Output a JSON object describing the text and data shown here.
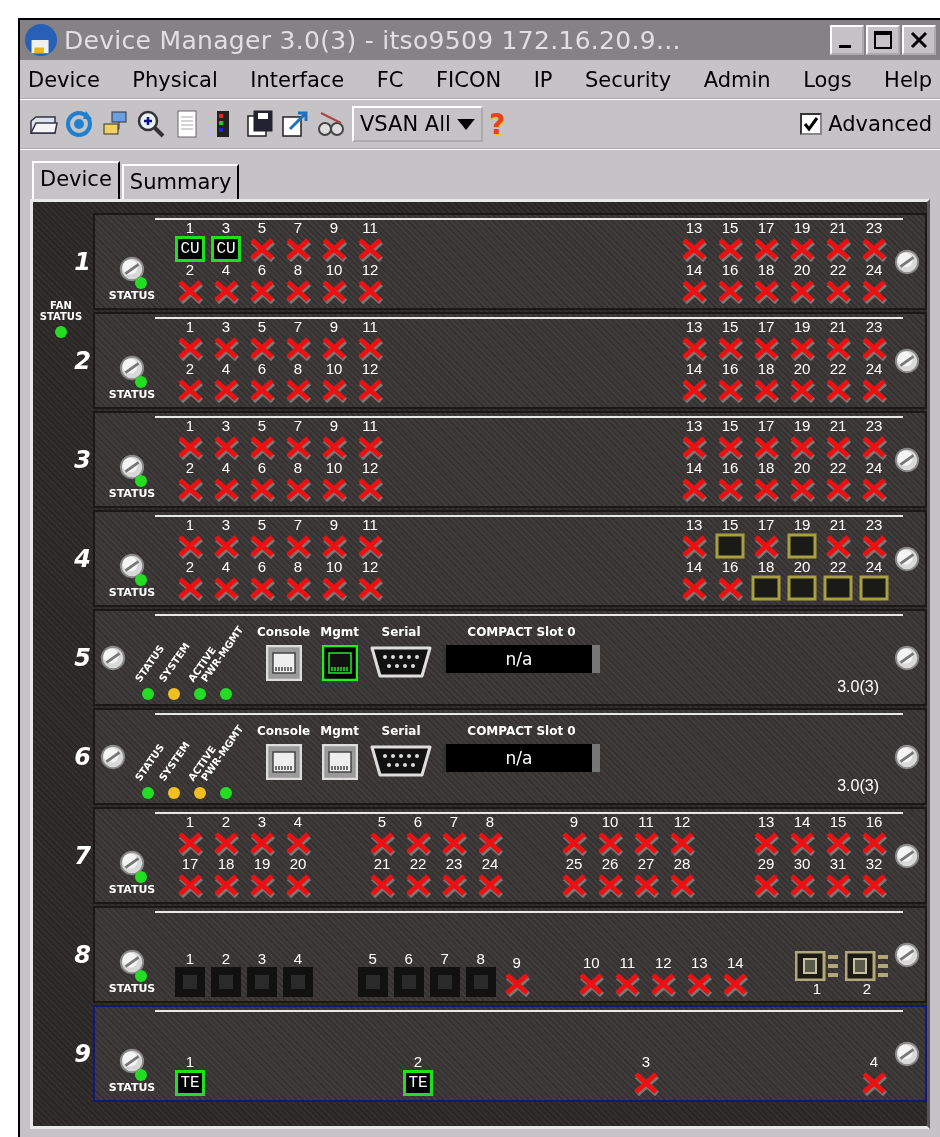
{
  "window": {
    "title": "Device Manager 3.0(3) - itso9509 172.16.20.9..."
  },
  "menu": [
    "Device",
    "Physical",
    "Interface",
    "FC",
    "FICON",
    "IP",
    "Security",
    "Admin",
    "Logs",
    "Help"
  ],
  "toolbar": {
    "vsan": "VSAN All",
    "help": "?",
    "advanced": {
      "label": "Advanced",
      "checked": true
    }
  },
  "tabs": [
    {
      "label": "Device",
      "selected": true
    },
    {
      "label": "Summary",
      "selected": false
    }
  ],
  "fan_status": "FAN STATUS",
  "slots": [
    {
      "number": "1",
      "kind": "ports",
      "selected": false,
      "status": "STATUS",
      "groups": [
        {
          "rows": [
            [
              {
                "label": "1",
                "kind": "up",
                "text": "CU"
              },
              {
                "label": "3",
                "kind": "up",
                "text": "CU"
              },
              {
                "label": "5",
                "kind": "down"
              },
              {
                "label": "7",
                "kind": "down"
              },
              {
                "label": "9",
                "kind": "down"
              },
              {
                "label": "11",
                "kind": "down"
              }
            ],
            [
              {
                "label": "2",
                "kind": "down"
              },
              {
                "label": "4",
                "kind": "down"
              },
              {
                "label": "6",
                "kind": "down"
              },
              {
                "label": "8",
                "kind": "down"
              },
              {
                "label": "10",
                "kind": "down"
              },
              {
                "label": "12",
                "kind": "down"
              }
            ]
          ]
        },
        {
          "rows": [
            [
              {
                "label": "13",
                "kind": "down"
              },
              {
                "label": "15",
                "kind": "down"
              },
              {
                "label": "17",
                "kind": "down"
              },
              {
                "label": "19",
                "kind": "down"
              },
              {
                "label": "21",
                "kind": "down"
              },
              {
                "label": "23",
                "kind": "down"
              }
            ],
            [
              {
                "label": "14",
                "kind": "down"
              },
              {
                "label": "16",
                "kind": "down"
              },
              {
                "label": "18",
                "kind": "down"
              },
              {
                "label": "20",
                "kind": "down"
              },
              {
                "label": "22",
                "kind": "down"
              },
              {
                "label": "24",
                "kind": "down"
              }
            ]
          ]
        }
      ]
    },
    {
      "number": "2",
      "kind": "ports",
      "selected": false,
      "status": "STATUS",
      "groups": [
        {
          "rows": [
            [
              {
                "label": "1",
                "kind": "down"
              },
              {
                "label": "3",
                "kind": "down"
              },
              {
                "label": "5",
                "kind": "down"
              },
              {
                "label": "7",
                "kind": "down"
              },
              {
                "label": "9",
                "kind": "down"
              },
              {
                "label": "11",
                "kind": "down"
              }
            ],
            [
              {
                "label": "2",
                "kind": "down"
              },
              {
                "label": "4",
                "kind": "down"
              },
              {
                "label": "6",
                "kind": "down"
              },
              {
                "label": "8",
                "kind": "down"
              },
              {
                "label": "10",
                "kind": "down"
              },
              {
                "label": "12",
                "kind": "down"
              }
            ]
          ]
        },
        {
          "rows": [
            [
              {
                "label": "13",
                "kind": "down"
              },
              {
                "label": "15",
                "kind": "down"
              },
              {
                "label": "17",
                "kind": "down"
              },
              {
                "label": "19",
                "kind": "down"
              },
              {
                "label": "21",
                "kind": "down"
              },
              {
                "label": "23",
                "kind": "down"
              }
            ],
            [
              {
                "label": "14",
                "kind": "down"
              },
              {
                "label": "16",
                "kind": "down"
              },
              {
                "label": "18",
                "kind": "down"
              },
              {
                "label": "20",
                "kind": "down"
              },
              {
                "label": "22",
                "kind": "down"
              },
              {
                "label": "24",
                "kind": "down"
              }
            ]
          ]
        }
      ]
    },
    {
      "number": "3",
      "kind": "ports",
      "selected": false,
      "status": "STATUS",
      "groups": [
        {
          "rows": [
            [
              {
                "label": "1",
                "kind": "down"
              },
              {
                "label": "3",
                "kind": "down"
              },
              {
                "label": "5",
                "kind": "down"
              },
              {
                "label": "7",
                "kind": "down"
              },
              {
                "label": "9",
                "kind": "down"
              },
              {
                "label": "11",
                "kind": "down"
              }
            ],
            [
              {
                "label": "2",
                "kind": "down"
              },
              {
                "label": "4",
                "kind": "down"
              },
              {
                "label": "6",
                "kind": "down"
              },
              {
                "label": "8",
                "kind": "down"
              },
              {
                "label": "10",
                "kind": "down"
              },
              {
                "label": "12",
                "kind": "down"
              }
            ]
          ]
        },
        {
          "rows": [
            [
              {
                "label": "13",
                "kind": "down"
              },
              {
                "label": "15",
                "kind": "down"
              },
              {
                "label": "17",
                "kind": "down"
              },
              {
                "label": "19",
                "kind": "down"
              },
              {
                "label": "21",
                "kind": "down"
              },
              {
                "label": "23",
                "kind": "down"
              }
            ],
            [
              {
                "label": "14",
                "kind": "down"
              },
              {
                "label": "16",
                "kind": "down"
              },
              {
                "label": "18",
                "kind": "down"
              },
              {
                "label": "20",
                "kind": "down"
              },
              {
                "label": "22",
                "kind": "down"
              },
              {
                "label": "24",
                "kind": "down"
              }
            ]
          ]
        }
      ]
    },
    {
      "number": "4",
      "kind": "ports",
      "selected": false,
      "status": "STATUS",
      "groups": [
        {
          "rows": [
            [
              {
                "label": "1",
                "kind": "down"
              },
              {
                "label": "3",
                "kind": "down"
              },
              {
                "label": "5",
                "kind": "down"
              },
              {
                "label": "7",
                "kind": "down"
              },
              {
                "label": "9",
                "kind": "down"
              },
              {
                "label": "11",
                "kind": "down"
              }
            ],
            [
              {
                "label": "2",
                "kind": "down"
              },
              {
                "label": "4",
                "kind": "down"
              },
              {
                "label": "6",
                "kind": "down"
              },
              {
                "label": "8",
                "kind": "down"
              },
              {
                "label": "10",
                "kind": "down"
              },
              {
                "label": "12",
                "kind": "down"
              }
            ]
          ]
        },
        {
          "rows": [
            [
              {
                "label": "13",
                "kind": "down"
              },
              {
                "label": "15",
                "kind": "empty"
              },
              {
                "label": "17",
                "kind": "down"
              },
              {
                "label": "19",
                "kind": "empty"
              },
              {
                "label": "21",
                "kind": "down"
              },
              {
                "label": "23",
                "kind": "down"
              }
            ],
            [
              {
                "label": "14",
                "kind": "down"
              },
              {
                "label": "16",
                "kind": "down"
              },
              {
                "label": "18",
                "kind": "empty"
              },
              {
                "label": "20",
                "kind": "empty"
              },
              {
                "label": "22",
                "kind": "empty"
              },
              {
                "label": "24",
                "kind": "empty"
              }
            ]
          ]
        }
      ]
    },
    {
      "number": "5",
      "kind": "supervisor",
      "selected": false,
      "leds": [
        {
          "label": "STATUS",
          "color": "#22dd22"
        },
        {
          "label": "SYSTEM",
          "color": "#f0c020"
        },
        {
          "label": "ACTIVE",
          "color": "#22dd22"
        },
        {
          "label": "PWR-MGMT",
          "color": "#22dd22"
        }
      ],
      "connectors": [
        {
          "label": "Console",
          "kind": "rj45",
          "active": false
        },
        {
          "label": "Mgmt",
          "kind": "rj45",
          "active": true
        },
        {
          "label": "Serial",
          "kind": "db9",
          "active": false
        }
      ],
      "flash": {
        "label": "COMPACT Slot 0",
        "value": "n/a"
      },
      "version": "3.0(3)"
    },
    {
      "number": "6",
      "kind": "supervisor",
      "selected": false,
      "leds": [
        {
          "label": "STATUS",
          "color": "#22dd22"
        },
        {
          "label": "SYSTEM",
          "color": "#f0c020"
        },
        {
          "label": "ACTIVE",
          "color": "#f0c020"
        },
        {
          "label": "PWR-MGMT",
          "color": "#22dd22"
        }
      ],
      "connectors": [
        {
          "label": "Console",
          "kind": "rj45",
          "active": false
        },
        {
          "label": "Mgmt",
          "kind": "rj45",
          "active": false
        },
        {
          "label": "Serial",
          "kind": "db9",
          "active": false
        }
      ],
      "flash": {
        "label": "COMPACT Slot 0",
        "value": "n/a"
      },
      "version": "3.0(3)"
    },
    {
      "number": "7",
      "kind": "ports",
      "selected": false,
      "status": "STATUS",
      "groups": [
        {
          "rows": [
            [
              {
                "label": "1",
                "kind": "down"
              },
              {
                "label": "2",
                "kind": "down"
              },
              {
                "label": "3",
                "kind": "down"
              },
              {
                "label": "4",
                "kind": "down"
              }
            ],
            [
              {
                "label": "17",
                "kind": "down"
              },
              {
                "label": "18",
                "kind": "down"
              },
              {
                "label": "19",
                "kind": "down"
              },
              {
                "label": "20",
                "kind": "down"
              }
            ]
          ]
        },
        {
          "rows": [
            [
              {
                "label": "5",
                "kind": "down"
              },
              {
                "label": "6",
                "kind": "down"
              },
              {
                "label": "7",
                "kind": "down"
              },
              {
                "label": "8",
                "kind": "down"
              }
            ],
            [
              {
                "label": "21",
                "kind": "down"
              },
              {
                "label": "22",
                "kind": "down"
              },
              {
                "label": "23",
                "kind": "down"
              },
              {
                "label": "24",
                "kind": "down"
              }
            ]
          ]
        },
        {
          "rows": [
            [
              {
                "label": "9",
                "kind": "down"
              },
              {
                "label": "10",
                "kind": "down"
              },
              {
                "label": "11",
                "kind": "down"
              },
              {
                "label": "12",
                "kind": "down"
              }
            ],
            [
              {
                "label": "25",
                "kind": "down"
              },
              {
                "label": "26",
                "kind": "down"
              },
              {
                "label": "27",
                "kind": "down"
              },
              {
                "label": "28",
                "kind": "down"
              }
            ]
          ]
        },
        {
          "rows": [
            [
              {
                "label": "13",
                "kind": "down"
              },
              {
                "label": "14",
                "kind": "down"
              },
              {
                "label": "15",
                "kind": "down"
              },
              {
                "label": "16",
                "kind": "down"
              }
            ],
            [
              {
                "label": "29",
                "kind": "down"
              },
              {
                "label": "30",
                "kind": "down"
              },
              {
                "label": "31",
                "kind": "down"
              },
              {
                "label": "32",
                "kind": "down"
              }
            ]
          ]
        }
      ]
    },
    {
      "number": "8",
      "kind": "ports",
      "selected": false,
      "status": "STATUS",
      "groups": [
        {
          "rows": [
            [
              {
                "label": "1",
                "kind": "blank"
              },
              {
                "label": "2",
                "kind": "blank"
              },
              {
                "label": "3",
                "kind": "blank"
              },
              {
                "label": "4",
                "kind": "blank"
              }
            ]
          ]
        },
        {
          "rows": [
            [
              {
                "label": "5",
                "kind": "blank"
              },
              {
                "label": "6",
                "kind": "blank"
              },
              {
                "label": "7",
                "kind": "blank"
              },
              {
                "label": "8",
                "kind": "blank"
              },
              {
                "label": "9",
                "kind": "down"
              }
            ]
          ]
        },
        {
          "rows": [
            [
              {
                "label": "10",
                "kind": "down"
              },
              {
                "label": "11",
                "kind": "down"
              },
              {
                "label": "12",
                "kind": "down"
              },
              {
                "label": "13",
                "kind": "down"
              },
              {
                "label": "14",
                "kind": "down"
              }
            ]
          ]
        },
        {
          "rows": [
            [
              {
                "label": "1",
                "kind": "gbic"
              },
              {
                "label": "2",
                "kind": "gbic"
              }
            ]
          ]
        }
      ]
    },
    {
      "number": "9",
      "kind": "ports",
      "selected": true,
      "status": "STATUS",
      "groups": [
        {
          "rows": [
            [
              {
                "label": "1",
                "kind": "up",
                "text": "TE"
              }
            ]
          ]
        },
        {
          "rows": [
            [
              {
                "label": "2",
                "kind": "up",
                "text": "TE"
              }
            ]
          ]
        },
        {
          "rows": [
            [
              {
                "label": "3",
                "kind": "down"
              }
            ]
          ]
        },
        {
          "rows": [
            [
              {
                "label": "4",
                "kind": "down"
              }
            ]
          ]
        }
      ]
    }
  ]
}
